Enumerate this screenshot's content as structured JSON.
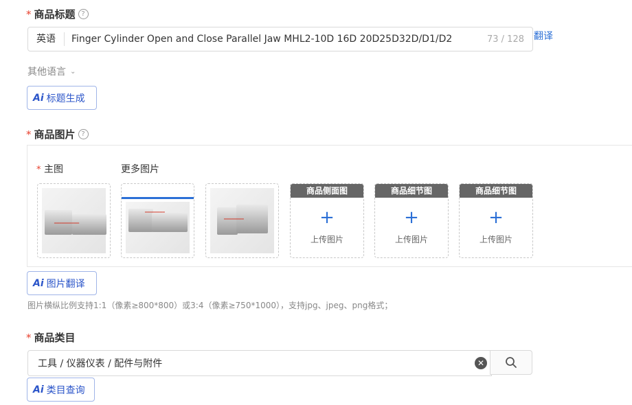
{
  "title_section": {
    "required_mark": "*",
    "label": "商品标题",
    "help_icon": "question-circle-icon",
    "lang_prefix": "英语",
    "title_value": "Finger Cylinder  Open and Close Parallel Jaw MHL2-10D 16D 20D25D32D/D1/D2",
    "char_count": "73 / 128",
    "translate_link": "翻译",
    "other_lang": "其他语言",
    "ai_button": "标题生成",
    "ai_mark": "Ai"
  },
  "image_section": {
    "required_mark": "*",
    "label": "商品图片",
    "main_label": "主图",
    "more_label": "更多图片",
    "empty_slots": [
      {
        "head": "商品侧面图",
        "text": "上传图片"
      },
      {
        "head": "商品细节图",
        "text": "上传图片"
      },
      {
        "head": "商品细节图",
        "text": "上传图片"
      }
    ],
    "ai_button": "图片翻译",
    "ai_mark": "Ai",
    "hint": "图片横纵比例支持1:1（像素≥800*800）或3:4（像素≥750*1000），支持jpg、jpeg、png格式；"
  },
  "category_section": {
    "required_mark": "*",
    "label": "商品类目",
    "value": "工具 / 仪器仪表 / 配件与附件",
    "clear_icon": "clear-circle-icon",
    "search_icon": "search-icon",
    "ai_button": "类目查询",
    "ai_mark": "Ai"
  },
  "colors": {
    "accent": "#2b6fd6",
    "required": "#e8412f",
    "ai_blue": "#2b55c9"
  }
}
